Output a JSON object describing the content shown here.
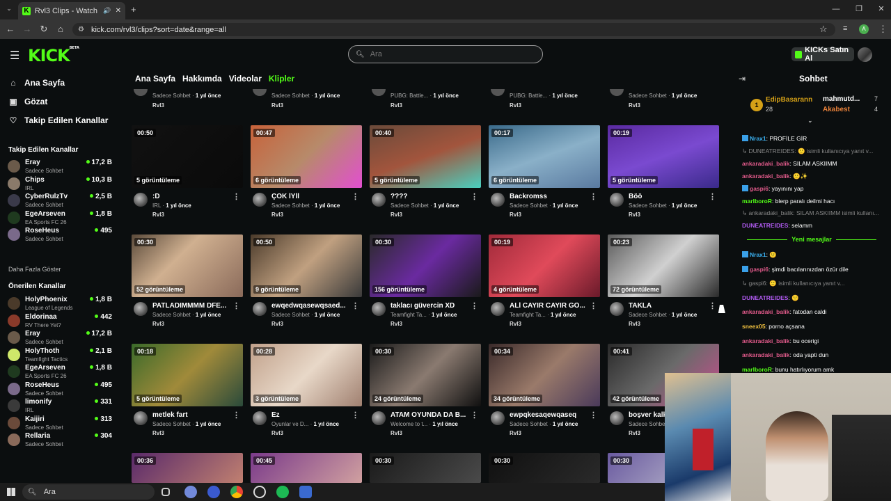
{
  "browser": {
    "tab_title": "Rvl3 Clips - Watch Live on K",
    "url": "kick.com/rvl3/clips?sort=date&range=all"
  },
  "header": {
    "logo": "KICK",
    "logo_badge": "BETA",
    "search_placeholder": "Ara",
    "buy_button": "KICKs Satın Al"
  },
  "sidebar": {
    "nav": [
      {
        "label": "Ana Sayfa",
        "icon": "home-icon"
      },
      {
        "label": "Gözat",
        "icon": "browse-icon"
      },
      {
        "label": "Takip Edilen Kanallar",
        "icon": "heart-icon"
      }
    ],
    "followed_title": "Takip Edilen Kanallar",
    "followed": [
      {
        "name": "Eray",
        "category": "Sadece Sohbet",
        "viewers": "17,2 B",
        "color": "#6a5a4a"
      },
      {
        "name": "Chips",
        "category": "IRL",
        "viewers": "10,3 B",
        "color": "#8a7a6a"
      },
      {
        "name": "CyberRulzTv",
        "category": "Sadece Sohbet",
        "viewers": "2,5 B",
        "color": "#3a3a4a"
      },
      {
        "name": "EgeArseven",
        "category": "EA Sports FC 26",
        "viewers": "1,8 B",
        "color": "#1f3a1f"
      },
      {
        "name": "RoseHeus",
        "category": "Sadece Sohbet",
        "viewers": "495",
        "color": "#7a6a8a"
      }
    ],
    "show_more": "Daha Fazla Göster",
    "recommended_title": "Önerilen Kanallar",
    "recommended": [
      {
        "name": "HolyPhoenix",
        "category": "League of Legends",
        "viewers": "1,8 B",
        "color": "#4a3a2a"
      },
      {
        "name": "Eldorinaa",
        "category": "RV There Yet?",
        "viewers": "442",
        "color": "#8a3a2a"
      },
      {
        "name": "Eray",
        "category": "Sadece Sohbet",
        "viewers": "17,2 B",
        "color": "#6a5a4a"
      },
      {
        "name": "HolyThoth",
        "category": "Teamfight Tactics",
        "viewers": "2,1 B",
        "color": "#cfe86a"
      },
      {
        "name": "EgeArseven",
        "category": "EA Sports FC 26",
        "viewers": "1,8 B",
        "color": "#1f3a1f"
      },
      {
        "name": "RoseHeus",
        "category": "Sadece Sohbet",
        "viewers": "495",
        "color": "#7a6a8a"
      },
      {
        "name": "limonify",
        "category": "IRL",
        "viewers": "331",
        "color": "#3a3a3a"
      },
      {
        "name": "Kaijiri",
        "category": "Sadece Sohbet",
        "viewers": "313",
        "color": "#6a4a3a"
      },
      {
        "name": "Rellaria",
        "category": "Sadece Sohbet",
        "viewers": "304",
        "color": "#8a6a5a"
      }
    ]
  },
  "tabs": [
    {
      "label": "Ana Sayfa",
      "active": false
    },
    {
      "label": "Hakkımda",
      "active": false
    },
    {
      "label": "Videolar",
      "active": false
    },
    {
      "label": "Klipler",
      "active": true
    }
  ],
  "top_partial_row": [
    {
      "meta": "Sadece Sohbet",
      "time": "1 yıl önce",
      "channel": "Rvl3"
    },
    {
      "meta": "Sadece Sohbet",
      "time": "1 yıl önce",
      "channel": "Rvl3"
    },
    {
      "meta": "PUBG: Battle...",
      "time": "1 yıl önce",
      "channel": "Rvl3"
    },
    {
      "meta": "PUBG: Battle...",
      "time": "1 yıl önce",
      "channel": "Rvl3"
    },
    {
      "meta": "Sadece Sohbet",
      "time": "1 yıl önce",
      "channel": "Rvl3"
    }
  ],
  "clips": [
    {
      "duration": "00:50",
      "views": "5 görüntüleme",
      "title": ":D",
      "category": "IRL",
      "time": "1 yıl önce",
      "channel": "Rvl3",
      "thumb": "linear-gradient(135deg,#111,#0a0a0a)"
    },
    {
      "duration": "00:47",
      "views": "6 görüntüleme",
      "title": "ÇOK İYİİ",
      "category": "Sadece Sohbet",
      "time": "1 yıl önce",
      "channel": "Rvl3",
      "thumb": "linear-gradient(135deg,#c7623a,#b78a6a 50%,#e24fd0)"
    },
    {
      "duration": "00:40",
      "views": "5 görüntüleme",
      "title": "????",
      "category": "Sadece Sohbet",
      "time": "1 yıl önce",
      "channel": "Rvl3",
      "thumb": "linear-gradient(160deg,#6a4a3a,#a2553d 50%,#4ad0c0)"
    },
    {
      "duration": "00:17",
      "views": "6 görüntüleme",
      "title": "Backromss",
      "category": "Sadece Sohbet",
      "time": "1 yıl önce",
      "channel": "Rvl3",
      "thumb": "linear-gradient(160deg,#3a6a8a,#8ab0c8 50%,#5a7aa0)"
    },
    {
      "duration": "00:19",
      "views": "5 görüntüleme",
      "title": "Böö",
      "category": "Sadece Sohbet",
      "time": "1 yıl önce",
      "channel": "Rvl3",
      "thumb": "linear-gradient(160deg,#5a2aa0,#7a4ad0 50%,#3a2a8a)"
    },
    {
      "duration": "00:30",
      "views": "52 görüntüleme",
      "title": "PATLADIMMMM DFE...",
      "category": "Sadece Sohbet",
      "time": "1 yıl önce",
      "channel": "Rvl3",
      "thumb": "linear-gradient(135deg,#5a4a3a,#d0b090 40%,#8a6a5a)"
    },
    {
      "duration": "00:50",
      "views": "9 görüntüleme",
      "title": "ewqedwqasewqsaed...",
      "category": "Sadece Sohbet",
      "time": "1 yıl önce",
      "channel": "Rvl3",
      "thumb": "linear-gradient(135deg,#4a3a2a,#c0a080 50%,#3a3a3a)"
    },
    {
      "duration": "00:30",
      "views": "156 görüntüleme",
      "title": "taklacı güvercin XD",
      "category": "Teamfight Ta...",
      "time": "1 yıl önce",
      "channel": "Rvl3",
      "thumb": "linear-gradient(135deg,#2a2a2a,#6a2aa0 50%,#1a1a1a)"
    },
    {
      "duration": "00:19",
      "views": "4 görüntüleme",
      "title": "ALİ CAYIR CAYIR GÖ...",
      "category": "Teamfight Ta...",
      "time": "1 yıl önce",
      "channel": "Rvl3",
      "thumb": "linear-gradient(135deg,#a02a3a,#e04a5a 50%,#6a1a2a)"
    },
    {
      "duration": "00:23",
      "views": "72 görüntüleme",
      "title": "TAKLA",
      "category": "Sadece Sohbet",
      "time": "1 yıl önce",
      "channel": "Rvl3",
      "thumb": "linear-gradient(135deg,#5a5a5a,#d0d0d0 50%,#2a2a2a)"
    },
    {
      "duration": "00:18",
      "views": "5 görüntüleme",
      "title": "metlek fart",
      "category": "Sadece Sohbet",
      "time": "1 yıl önce",
      "channel": "Rvl3",
      "thumb": "linear-gradient(135deg,#3a6a2a,#a08a3a 50%,#2a4a3a)"
    },
    {
      "duration": "00:28",
      "views": "3 görüntüleme",
      "title": "Ez",
      "category": "Oyunlar ve D...",
      "time": "1 yıl önce",
      "channel": "Rvl3",
      "thumb": "linear-gradient(135deg,#c0a08a,#e8d8c8 50%,#a08070)"
    },
    {
      "duration": "00:30",
      "views": "24 görüntüleme",
      "title": "ATAM OYUNDA DA B...",
      "category": "Welcome to t...",
      "time": "1 yıl önce",
      "channel": "Rvl3",
      "thumb": "linear-gradient(135deg,#1a1a1a,#8a7a70 50%,#101010)"
    },
    {
      "duration": "00:34",
      "views": "34 görüntüleme",
      "title": "ewpqkesaqewqaseq",
      "category": "Sadece Sohbet",
      "time": "1 yıl önce",
      "channel": "Rvl3",
      "thumb": "linear-gradient(135deg,#3a2a2a,#9a7a6a 50%,#4a3a5a)"
    },
    {
      "duration": "00:41",
      "views": "42 görüntüleme",
      "title": "boşver kalk",
      "category": "Sadece Sohbet",
      "time": "1 yıl önce",
      "channel": "Rvl3",
      "thumb": "linear-gradient(135deg,#2a2a2a,#6a6a6a 50%,#d04a90)"
    }
  ],
  "bottom_partial_row": [
    {
      "duration": "00:36",
      "thumb": "linear-gradient(135deg,#5a2a6a,#c08070)"
    },
    {
      "duration": "00:45",
      "thumb": "linear-gradient(135deg,#7a3a8a,#d0a0a0)"
    },
    {
      "duration": "00:30",
      "thumb": "linear-gradient(135deg,#1a1a1a,#4a4a4a)"
    },
    {
      "duration": "00:30",
      "thumb": "linear-gradient(135deg,#101010,#2a2a2a)"
    },
    {
      "duration": "00:30",
      "thumb": "linear-gradient(135deg,#6a5aa0,#c0c0d0)"
    }
  ],
  "chat": {
    "title": "Sohbet",
    "pinned": {
      "rank1_name": "EdipBasarann",
      "rank1_value": "28",
      "rank2_name": "mahmutd...",
      "rank2_value": "7",
      "rank3_name": "Akabest",
      "rank3_value": "4"
    },
    "messages": [
      {
        "user": "Nrax1",
        "text": ": PROFİLE GİR",
        "color": "#3ab0f0",
        "badge": true,
        "reply": false
      },
      {
        "user": "",
        "text": "DUNEATREIDES: 🙂 isimli kullanıcıya yanıt v...",
        "color": "#888",
        "badge": false,
        "reply": true
      },
      {
        "user": "ankaradaki_balik",
        "text": ": SILAM ASKIIMM",
        "color": "#e05a8a",
        "badge": false,
        "reply": false
      },
      {
        "user": "ankaradaki_balik",
        "text": ": 🙂✨",
        "color": "#e05a8a",
        "badge": false,
        "reply": false
      },
      {
        "user": "gaspi6",
        "text": ": yayınını yap",
        "color": "#e05a8a",
        "badge": true,
        "reply": false
      },
      {
        "user": "marlboroR",
        "text": ": blerp paralı deilmi hacı",
        "color": "#53fc18",
        "badge": false,
        "reply": false
      },
      {
        "user": "",
        "text": "ankaradaki_balik: SILAM ASKIIMM isimli kullanı...",
        "color": "#888",
        "badge": false,
        "reply": true
      },
      {
        "user": "DUNEATREIDES",
        "text": ": selamm",
        "color": "#b05af0",
        "badge": false,
        "reply": false
      }
    ],
    "new_messages_label": "Yeni mesajlar",
    "messages_new": [
      {
        "user": "Nrax1",
        "text": ": 🙂",
        "color": "#3ab0f0",
        "badge": true,
        "reply": false
      },
      {
        "user": "gaspi6",
        "text": ": şimdi bacılarınızdan özür dile",
        "color": "#e05a8a",
        "badge": true,
        "reply": false
      },
      {
        "user": "",
        "text": "gaspi6: 🙂 isimli kullanıcıya yanıt v...",
        "color": "#888",
        "badge": false,
        "reply": true
      },
      {
        "user": "DUNEATREIDES",
        "text": ": 🙂",
        "color": "#b05af0",
        "badge": false,
        "reply": false
      },
      {
        "user": "ankaradaki_balik",
        "text": ": fatodan caldi",
        "color": "#e05a8a",
        "badge": false,
        "reply": false
      },
      {
        "user": "sneex05",
        "text": ": porno açsana",
        "color": "#f0c040",
        "badge": false,
        "reply": false
      },
      {
        "user": "ankaradaki_balik",
        "text": ": bu ocerigi",
        "color": "#e05a8a",
        "badge": false,
        "reply": false
      },
      {
        "user": "ankaradaki_balik",
        "text": ": oda yapti dun",
        "color": "#e05a8a",
        "badge": false,
        "reply": false
      },
      {
        "user": "marlboroR",
        "text": ": bunu hatırlıyorum amk",
        "color": "#53fc18",
        "badge": false,
        "reply": false
      }
    ]
  },
  "taskbar": {
    "search_placeholder": "Ara"
  },
  "colors": {
    "accent": "#53fc18",
    "background": "#0b0e0f"
  }
}
